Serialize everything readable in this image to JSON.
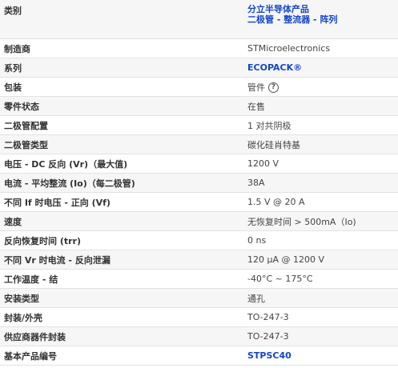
{
  "rows": [
    {
      "label": "类别",
      "value_line1": "分立半导体产品",
      "value_line2": "二极管 - 整流器 - 阵列"
    },
    {
      "label": "制造商",
      "value": "STMicroelectronics"
    },
    {
      "label": "系列",
      "value": "ECOPACK®"
    },
    {
      "label": "包装",
      "value": "管件",
      "help_icon": "question-circle-icon",
      "help_glyph": "?"
    },
    {
      "label": "零件状态",
      "value": "在售"
    },
    {
      "label": "二极管配置",
      "value": "1 对共阴极"
    },
    {
      "label": "二极管类型",
      "value": "碳化硅肖特基"
    },
    {
      "label": "电压 - DC 反向 (Vr)（最大值)",
      "value": "1200 V"
    },
    {
      "label": "电流 - 平均整流 (Io)（每二极管)",
      "value": "38A"
    },
    {
      "label": "不同 If 时电压 - 正向 (Vf)",
      "value": "1.5 V @ 20 A"
    },
    {
      "label": "速度",
      "value": "无恢复时间 > 500mA（Io)"
    },
    {
      "label": "反向恢复时间 (trr)",
      "value": "0 ns"
    },
    {
      "label": "不同 Vr 时电流 - 反向泄漏",
      "value": "120 µA @ 1200 V"
    },
    {
      "label": "工作温度 - 结",
      "value": "-40°C ~ 175°C"
    },
    {
      "label": "安装类型",
      "value": "通孔"
    },
    {
      "label": "封装/外壳",
      "value": "TO-247-3"
    },
    {
      "label": "供应商器件封装",
      "value": "TO-247-3"
    },
    {
      "label": "基本产品编号",
      "value": "STPSC40"
    }
  ],
  "colors": {
    "link": "#1545c8",
    "stripe": "#f6f6f6",
    "border": "#e2e2e2"
  }
}
